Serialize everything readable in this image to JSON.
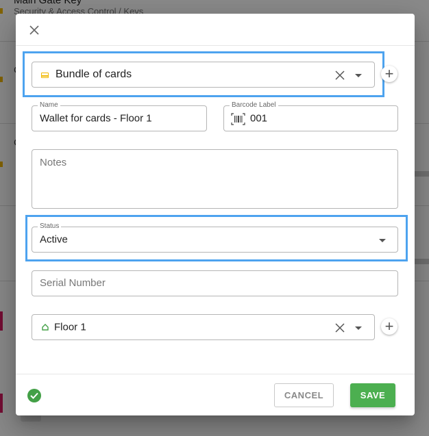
{
  "background": {
    "title": "Main Gate Key",
    "subtitle": "Security & Access Control / Keys"
  },
  "dialog": {
    "close_icon": "close-icon",
    "container": {
      "value": "Bundle of cards",
      "icon": "card-icon",
      "icon_color": "#f1b800"
    },
    "name": {
      "label": "Name",
      "value": "Wallet for cards - Floor 1"
    },
    "barcode": {
      "label": "Barcode Label",
      "value": "001",
      "icon": "barcode-icon"
    },
    "notes": {
      "placeholder": "Notes",
      "value": ""
    },
    "status": {
      "label": "Status",
      "value": "Active"
    },
    "serial": {
      "placeholder": "Serial Number",
      "value": ""
    },
    "location": {
      "value": "Floor 1",
      "icon": "home-icon",
      "icon_color": "#43a047"
    },
    "footer": {
      "status_icon": "check-circle-icon",
      "cancel_label": "CANCEL",
      "save_label": "SAVE",
      "save_color": "#4caf50"
    },
    "highlight_color": "#4da3ef"
  }
}
